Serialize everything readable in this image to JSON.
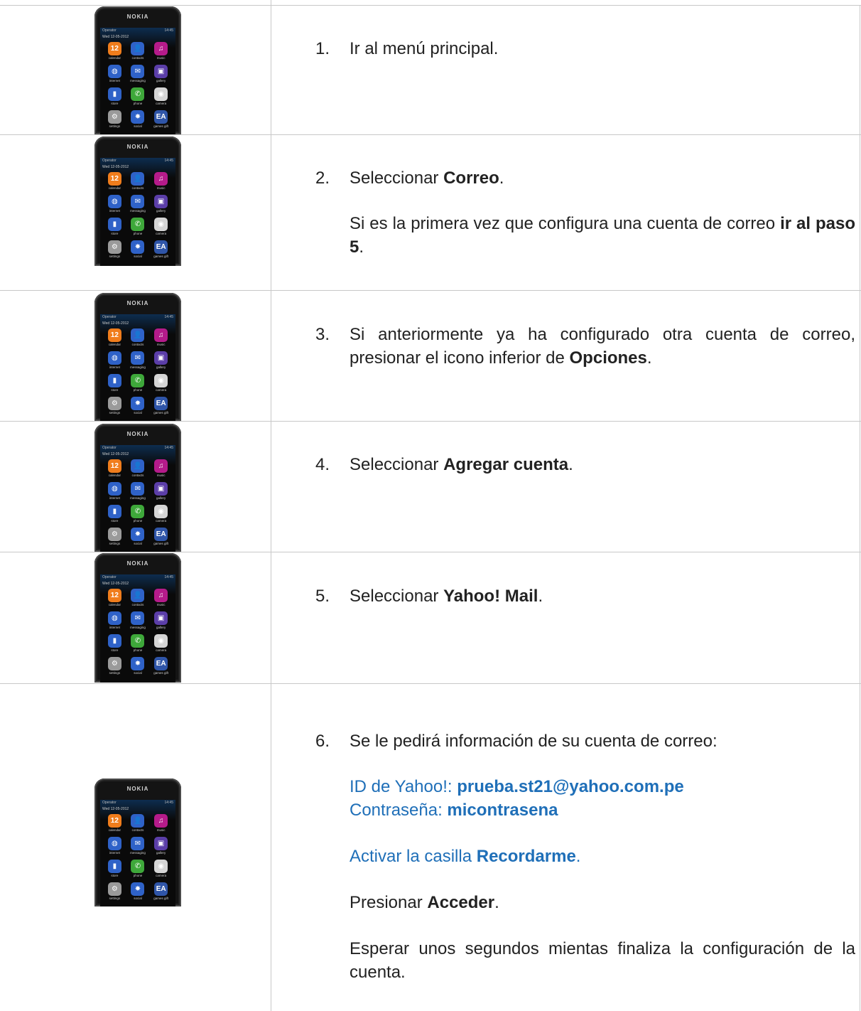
{
  "phone": {
    "brand": "NOKIA",
    "operator": "Operator",
    "time": "14:45",
    "date": "Wed 12-05-2012",
    "apps": [
      {
        "icon": "calendar-icon",
        "glyph": "12",
        "label": "calendar",
        "color": "#f07d1c"
      },
      {
        "icon": "contacts-icon",
        "glyph": "👤",
        "label": "contacts",
        "color": "#2f62c8"
      },
      {
        "icon": "music-icon",
        "glyph": "♫",
        "label": "music",
        "color": "#b51b8a"
      },
      {
        "icon": "internet-icon",
        "glyph": "◍",
        "label": "internet",
        "color": "#2f62c8"
      },
      {
        "icon": "messaging-icon",
        "glyph": "✉",
        "label": "messaging",
        "color": "#2f62c8"
      },
      {
        "icon": "gallery-icon",
        "glyph": "▣",
        "label": "gallery",
        "color": "#5b3ea8"
      },
      {
        "icon": "store-icon",
        "glyph": "▮",
        "label": "store",
        "color": "#2f62c8"
      },
      {
        "icon": "phone-icon",
        "glyph": "✆",
        "label": "phone",
        "color": "#3ea83a"
      },
      {
        "icon": "camera-icon",
        "glyph": "◉",
        "label": "camera",
        "color": "#d5d5d5"
      },
      {
        "icon": "settings-icon",
        "glyph": "⚙",
        "label": "settings",
        "color": "#9a9a9a"
      },
      {
        "icon": "social-icon",
        "glyph": "✸",
        "label": "social",
        "color": "#2f62c8"
      },
      {
        "icon": "games-gift-icon",
        "glyph": "EA",
        "label": "games gift",
        "color": "#2f55a8"
      }
    ]
  },
  "steps": [
    {
      "num": "1.",
      "pre": "Ir al menú principal.",
      "bold": "",
      "post": ""
    },
    {
      "num": "2.",
      "pre": "Seleccionar ",
      "bold": "Correo",
      "post": ".",
      "extra_pre": "Si es la primera vez que configura una cuenta de correo ",
      "extra_bold": "ir al paso 5",
      "extra_post": "."
    },
    {
      "num": "3.",
      "pre": "Si anteriormente ya ha configurado otra cuenta de correo, presionar el icono inferior de ",
      "bold": "Opciones",
      "post": "."
    },
    {
      "num": "4.",
      "pre": "Seleccionar ",
      "bold": "Agregar cuenta",
      "post": "."
    },
    {
      "num": "5.",
      "pre": "Seleccionar ",
      "bold": "Yahoo! Mail",
      "post": "."
    },
    {
      "num": "6.",
      "pre": "Se le pedirá información de su cuenta de correo:",
      "bold": "",
      "post": "",
      "id_label": "ID de Yahoo!: ",
      "id_value": "prueba.st21@yahoo.com.pe",
      "pw_label": "Contraseña: ",
      "pw_value": "micontrasena",
      "remember_pre": "Activar la casilla ",
      "remember_bold": "Recordarme",
      "remember_post": ".",
      "press_pre": "Presionar ",
      "press_bold": "Acceder",
      "press_post": ".",
      "wait": "Esperar unos segundos mientas finaliza la configuración de la cuenta."
    }
  ]
}
